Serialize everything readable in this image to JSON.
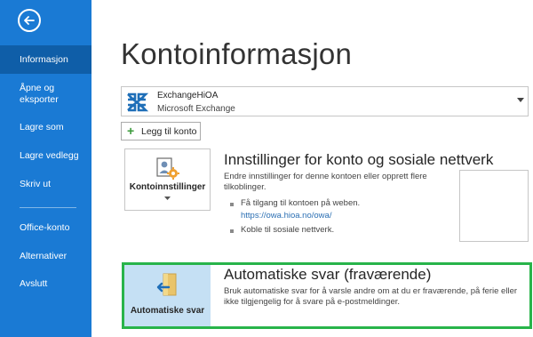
{
  "sidebar": {
    "back_icon": "arrow-left-icon",
    "items": [
      {
        "label": "Informasjon",
        "active": true
      },
      {
        "label": "Åpne og\neksporter"
      },
      {
        "label": "Lagre som"
      },
      {
        "label": "Lagre vedlegg"
      },
      {
        "label": "Skriv ut"
      },
      {
        "label": "Office-konto"
      },
      {
        "label": "Alternativer"
      },
      {
        "label": "Avslutt"
      }
    ],
    "colors": {
      "background": "#1a7ad4",
      "active": "#0f5ea8"
    }
  },
  "main": {
    "title": "Kontoinformasjon",
    "account": {
      "name": "ExchangeHiOA",
      "type": "Microsoft Exchange",
      "icon": "exchange-icon"
    },
    "add_account_label": "Legg til konto",
    "account_settings": {
      "button_label": "Kontoinnstillinger",
      "title": "Innstillinger for konto og sosiale nettverk",
      "description": "Endre innstillinger for denne kontoen eller opprett flere tilkoblinger.",
      "bullet_web": "Få tilgang til kontoen på weben.",
      "web_link": "https://owa.hioa.no/owa/",
      "bullet_social": "Koble til sosiale nettverk."
    },
    "auto_reply": {
      "button_label": "Automatiske svar",
      "title": "Automatiske svar (fraværende)",
      "description": "Bruk automatiske svar for å varsle andre om at du er fraværende, på ferie eller ikke tilgjengelig for å svare på e-postmeldinger.",
      "highlight_color": "#28b44a"
    }
  }
}
